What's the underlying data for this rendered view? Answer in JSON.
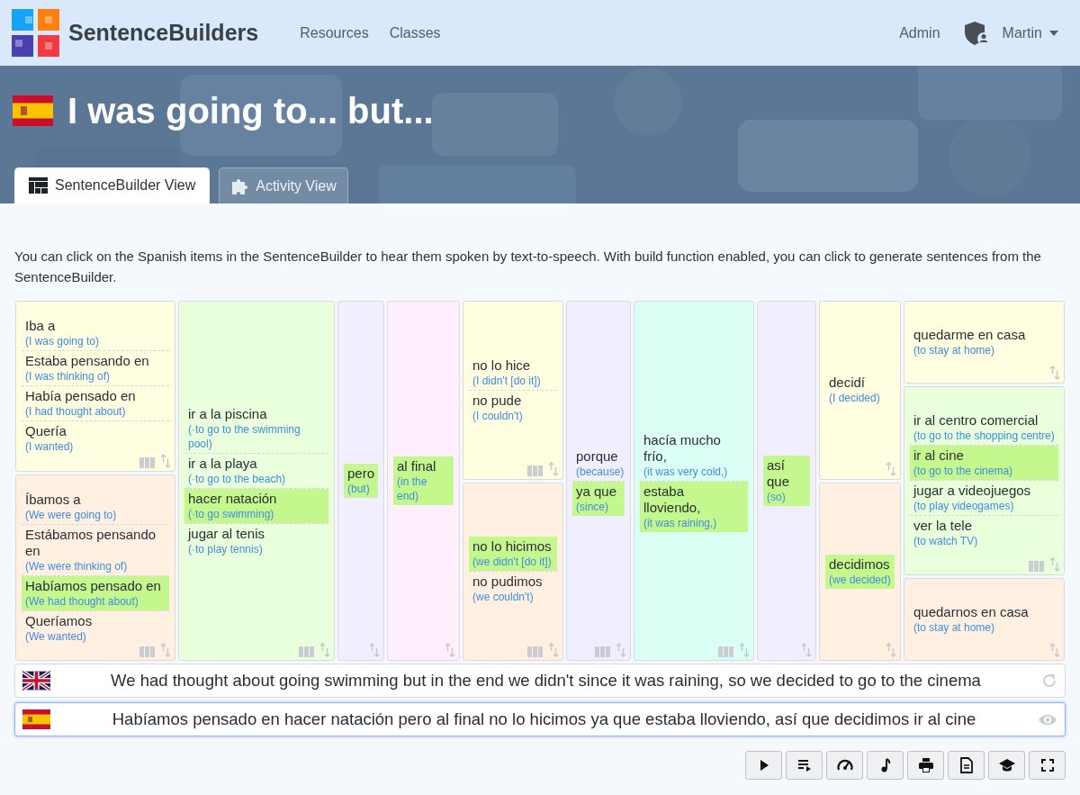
{
  "header": {
    "brand": "SentenceBuilders",
    "nav": [
      {
        "label": "Resources"
      },
      {
        "label": "Classes"
      }
    ],
    "admin": "Admin",
    "user": "Martin"
  },
  "title": "I was going to... but...",
  "tabs": [
    {
      "label": "SentenceBuilder View",
      "selected": true
    },
    {
      "label": "Activity View",
      "selected": false
    }
  ],
  "intro": "You can click on the Spanish items in the SentenceBuilder to hear them spoken by text-to-speech. With build function enabled, you can click to generate sentences from the SentenceBuilder.",
  "columns": [
    {
      "boxes": [
        {
          "color": "#fffee0",
          "items": [
            {
              "es": "Iba a",
              "en": "(I was going to)",
              "selected": false
            },
            {
              "es": "Estaba pensando en",
              "en": "(I was thinking of)",
              "selected": false
            },
            {
              "es": "Había pensado en",
              "en": "(I had thought about)",
              "selected": false
            },
            {
              "es": "Quería",
              "en": "(I wanted)",
              "selected": false
            }
          ]
        },
        {
          "color": "#fff0e1",
          "items": [
            {
              "es": "Íbamos a",
              "en": "(We were going to)",
              "selected": false
            },
            {
              "es": "Estábamos pensando en",
              "en": "(We were thinking of)",
              "selected": false
            },
            {
              "es": "Habíamos pensado en",
              "en": "(We had thought about)",
              "selected": true
            },
            {
              "es": "Queríamos",
              "en": "(We wanted)",
              "selected": false
            }
          ]
        }
      ]
    },
    {
      "boxes": [
        {
          "color": "#eaffdc",
          "items": [
            {
              "es": "ir a la piscina",
              "en": "(·to go to the swimming pool)",
              "selected": false
            },
            {
              "es": "ir a la playa",
              "en": "(·to go to the beach)",
              "selected": false
            },
            {
              "es": "hacer natación",
              "en": "(·to go swimming)",
              "selected": true
            },
            {
              "es": "jugar al tenis",
              "en": "(·to play tennis)",
              "selected": false
            }
          ]
        }
      ]
    },
    {
      "boxes": [
        {
          "color": "#f1eeff",
          "items": [
            {
              "es": "pero",
              "en": "(but)",
              "selected": true
            }
          ]
        }
      ]
    },
    {
      "boxes": [
        {
          "color": "#ffeefc",
          "items": [
            {
              "es": "al final",
              "en": "(in the end)",
              "selected": true
            }
          ]
        }
      ]
    },
    {
      "boxes": [
        {
          "color": "#fffee0",
          "items": [
            {
              "es": "no lo hice",
              "en": "(I didn't [do it])",
              "selected": false
            },
            {
              "es": "no pude",
              "en": "(I couldn't)",
              "selected": false
            }
          ]
        },
        {
          "color": "#fff0e1",
          "items": [
            {
              "es": "no lo hicimos",
              "en": "(we didn't [do it])",
              "selected": true
            },
            {
              "es": "no pudimos",
              "en": "(we couldn't)",
              "selected": false
            }
          ]
        }
      ]
    },
    {
      "boxes": [
        {
          "color": "#f1eeff",
          "items": [
            {
              "es": "porque",
              "en": "(because)",
              "selected": false
            },
            {
              "es": "ya que",
              "en": "(since)",
              "selected": true
            }
          ]
        }
      ]
    },
    {
      "boxes": [
        {
          "color": "#dcfff5",
          "items": [
            {
              "es": "hacía mucho frío,",
              "en": "(it was very cold,)",
              "selected": false
            },
            {
              "es": "estaba lloviendo,",
              "en": "(it was raining,)",
              "selected": true
            }
          ]
        }
      ]
    },
    {
      "boxes": [
        {
          "color": "#f1eeff",
          "items": [
            {
              "es": "así que",
              "en": "(so)",
              "selected": true
            }
          ]
        }
      ]
    },
    {
      "boxes": [
        {
          "color": "#fffee0",
          "items": [
            {
              "es": "decidí",
              "en": "(I decided)",
              "selected": false
            }
          ]
        },
        {
          "color": "#fff0e1",
          "items": [
            {
              "es": "decidimos",
              "en": "(we decided)",
              "selected": true
            }
          ]
        }
      ]
    },
    {
      "boxes": [
        {
          "color": "#fffee0",
          "items": [
            {
              "es": "quedarme en casa",
              "en": "(to stay at home)",
              "selected": false
            }
          ]
        },
        {
          "color": "#eaffdc",
          "items": [
            {
              "es": "ir al centro comercial",
              "en": "(to go to the shopping centre)",
              "selected": false
            },
            {
              "es": "ir al cine",
              "en": "(to go to the cinema)",
              "selected": true
            },
            {
              "es": "jugar a videojuegos",
              "en": "(to play videogames)",
              "selected": false
            },
            {
              "es": "ver la tele",
              "en": "(to watch TV)",
              "selected": false
            }
          ]
        },
        {
          "color": "#fff0e1",
          "items": [
            {
              "es": "quedarnos en casa",
              "en": "(to stay at home)",
              "selected": false
            }
          ]
        }
      ]
    }
  ],
  "sentences": [
    {
      "text": "We had thought about going swimming but in the end we didn't since it was raining, so we decided to go to the cinema"
    },
    {
      "text": "Habíamos pensado en hacer natación pero al final no lo hicimos ya que estaba lloviendo, así que decidimos ir al cine"
    }
  ]
}
